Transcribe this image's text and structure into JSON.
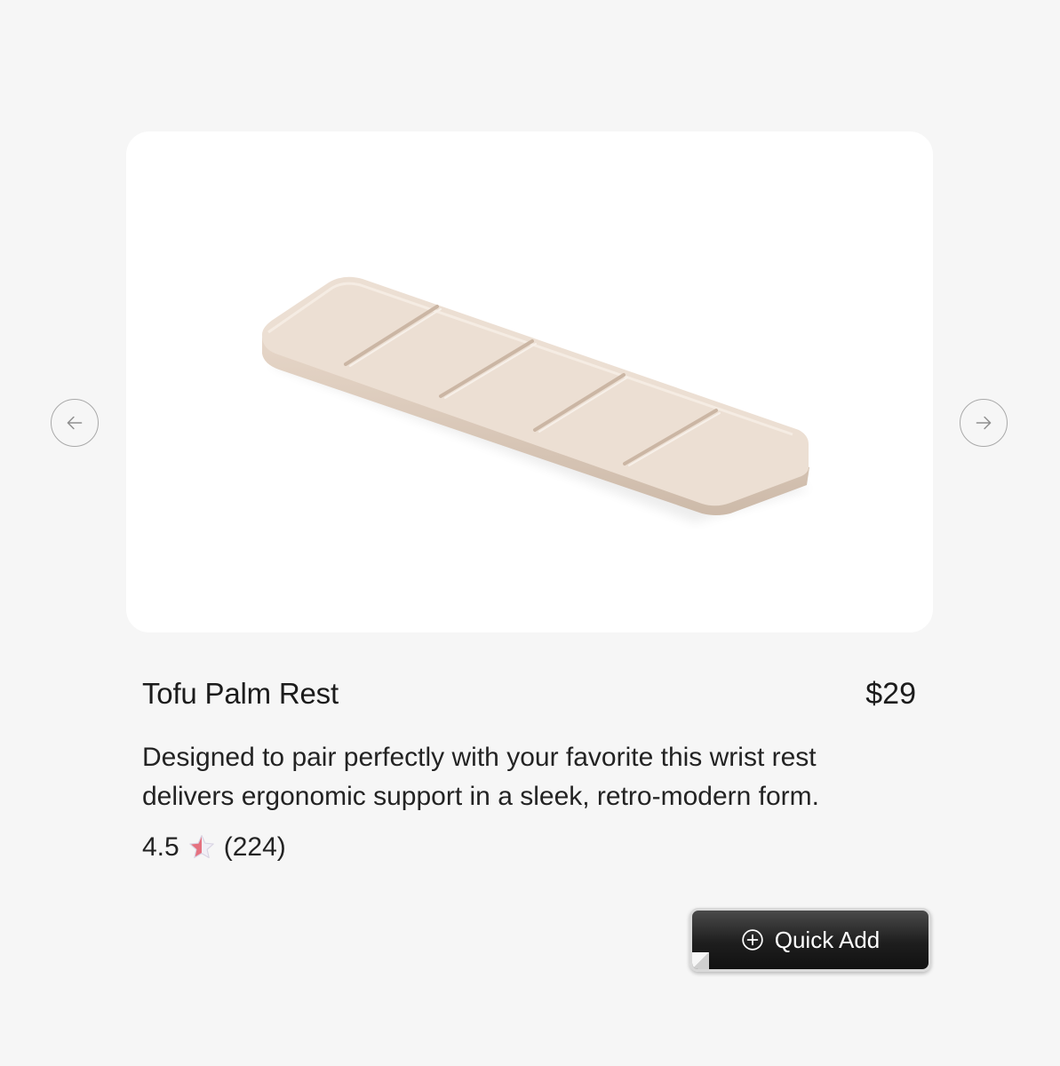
{
  "product": {
    "name": "Tofu Palm Rest",
    "price": "$29",
    "description": "Designed to pair perfectly with your favorite this wrist rest delivers ergonomic support in a sleek, retro-modern form.",
    "rating": "4.5",
    "review_count": "(224)",
    "product_color": "#ecdfd3"
  },
  "carousel": {
    "prev_icon": "arrow-left-icon",
    "next_icon": "arrow-right-icon"
  },
  "actions": {
    "quick_add_label": "Quick Add",
    "quick_add_icon": "plus-circle-icon"
  },
  "colors": {
    "background": "#f6f6f6",
    "card": "#ffffff",
    "button": "#1e1e1e",
    "star": "#e5717f"
  }
}
